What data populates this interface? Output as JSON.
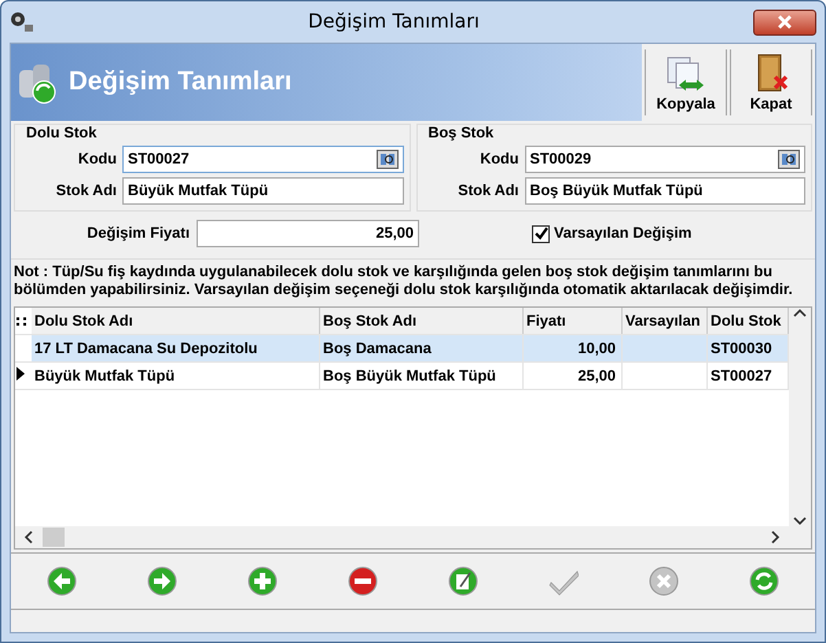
{
  "window": {
    "title": "Değişim Tanımları"
  },
  "header": {
    "title": "Değişim Tanımları",
    "buttons": [
      {
        "kind": "copy",
        "label": "Kopyala"
      },
      {
        "kind": "close",
        "label": "Kapat"
      }
    ]
  },
  "dolu_stok": {
    "title": "Dolu Stok",
    "kodu_label": "Kodu",
    "kodu": "ST00027",
    "stok_adi_label": "Stok Adı",
    "stok_adi": "Büyük Mutfak Tüpü"
  },
  "bos_stok": {
    "title": "Boş Stok",
    "kodu_label": "Kodu",
    "kodu": "ST00029",
    "stok_adi_label": "Stok Adı",
    "stok_adi": "Boş Büyük Mutfak Tüpü"
  },
  "price": {
    "label": "Değişim Fiyatı",
    "value": "25,00"
  },
  "default_exchange": {
    "label": "Varsayılan Değişim",
    "checked": true
  },
  "note": "Not : Tüp/Su fiş kaydında uygulanabilecek dolu stok ve karşılığında gelen boş stok değişim tanımlarını bu bölümden yapabilirsiniz. Varsayılan değişim seçeneği dolu stok karşılığında otomatik aktarılacak değişimdir.",
  "table": {
    "columns": [
      "Dolu Stok Adı",
      "Boş Stok Adı",
      "Fiyatı",
      "Varsayılan",
      "Dolu Stok"
    ],
    "rows": [
      {
        "cells": [
          "17 LT Damacana Su Depozitolu",
          "Boş Damacana",
          "10,00",
          "",
          "ST00030"
        ],
        "selected": true,
        "current": false
      },
      {
        "cells": [
          "Büyük Mutfak Tüpü",
          "Boş Büyük Mutfak Tüpü",
          "25,00",
          "",
          "ST00027"
        ],
        "selected": false,
        "current": true
      }
    ]
  },
  "toolbar": [
    {
      "kind": "prev",
      "disabled": false
    },
    {
      "kind": "next",
      "disabled": false
    },
    {
      "kind": "add",
      "disabled": false
    },
    {
      "kind": "delete",
      "disabled": false
    },
    {
      "kind": "edit",
      "disabled": false
    },
    {
      "kind": "save",
      "disabled": true
    },
    {
      "kind": "cancel",
      "disabled": true
    },
    {
      "kind": "refresh",
      "disabled": false
    }
  ]
}
